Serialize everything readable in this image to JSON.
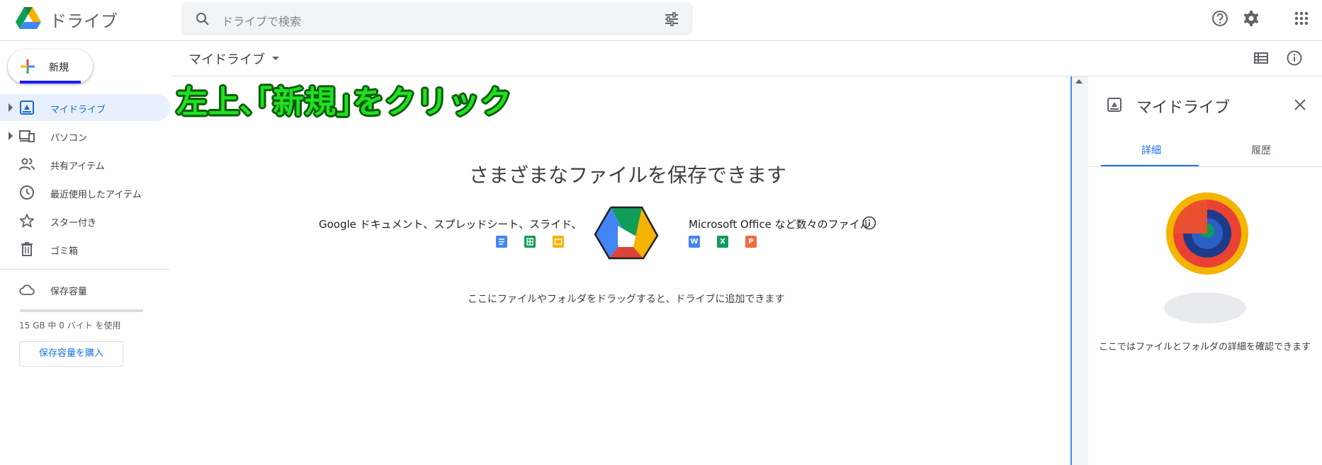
{
  "header": {
    "app_title": "ドライブ",
    "search_placeholder": "ドライブで検索",
    "icons": [
      "help-icon",
      "settings-icon",
      "apps-icon"
    ]
  },
  "sidebar": {
    "new_label": "新規",
    "items": [
      {
        "label": "マイドライブ",
        "icon": "my-drive-icon",
        "active": true,
        "expandable": true
      },
      {
        "label": "パソコン",
        "icon": "computers-icon",
        "active": false,
        "expandable": true
      },
      {
        "label": "共有アイテム",
        "icon": "shared-icon",
        "active": false,
        "expandable": false
      },
      {
        "label": "最近使用したアイテム",
        "icon": "recent-icon",
        "active": false,
        "expandable": false
      },
      {
        "label": "スター付き",
        "icon": "star-icon",
        "active": false,
        "expandable": false
      },
      {
        "label": "ゴミ箱",
        "icon": "trash-icon",
        "active": false,
        "expandable": false
      }
    ],
    "storage_label": "保存容量",
    "storage_usage": "15 GB 中 0 バイト を使用",
    "buy_storage": "保存容量を購入"
  },
  "toolbar": {
    "breadcrumb": "マイドライブ",
    "icons": [
      "list-view-icon",
      "info-icon"
    ]
  },
  "annotation": {
    "text": "左上､｢新規｣をクリック"
  },
  "main": {
    "empty_title": "さまざまなファイルを保存できます",
    "google_types": "Google ドキュメント、スプレッドシート、スライド、",
    "ms_types": "Microsoft Office など数々のファイル",
    "drop_hint": "ここにファイルやフォルダをドラッグすると、ドライブに追加できます",
    "file_badges": {
      "word": "W",
      "excel": "X",
      "powerpoint": "P"
    }
  },
  "details_pane": {
    "title": "マイドライブ",
    "tabs": [
      "詳細",
      "履歴"
    ],
    "active_tab": "詳細",
    "hint": "ここではファイルとフォルダの詳細を確認できます"
  },
  "colors": {
    "accent": "#1a73e8",
    "active_bg": "#e8f0fe",
    "annotation": "#20e020",
    "google_blue": "#4285f4",
    "google_green": "#0f9d58",
    "google_yellow": "#f4b400",
    "google_red": "#db4437"
  }
}
